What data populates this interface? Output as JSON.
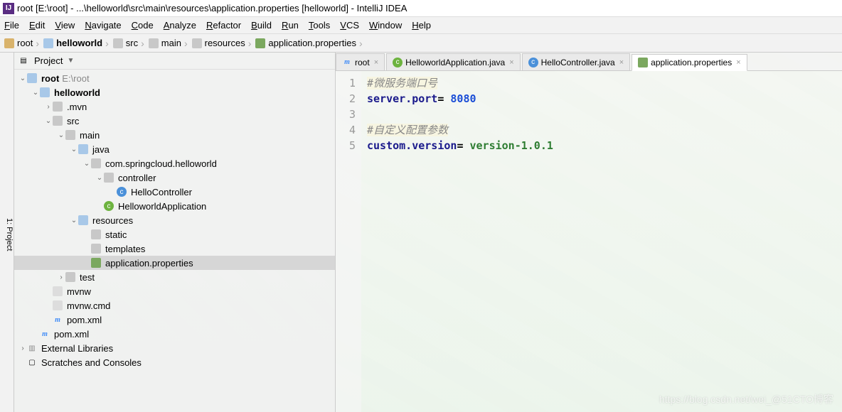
{
  "title": "root [E:\\root] - ...\\helloworld\\src\\main\\resources\\application.properties [helloworld] - IntelliJ IDEA",
  "menu": [
    "File",
    "Edit",
    "View",
    "Navigate",
    "Code",
    "Analyze",
    "Refactor",
    "Build",
    "Run",
    "Tools",
    "VCS",
    "Window",
    "Help"
  ],
  "breadcrumbs": [
    {
      "icon": "folder",
      "label": "root"
    },
    {
      "icon": "folder-blue",
      "label": "helloworld",
      "bold": true
    },
    {
      "icon": "folder-gray",
      "label": "src"
    },
    {
      "icon": "folder-gray",
      "label": "main"
    },
    {
      "icon": "folder-gray",
      "label": "resources"
    },
    {
      "icon": "prop",
      "label": "application.properties"
    }
  ],
  "project_label": "Project",
  "tree": [
    {
      "indent": 0,
      "tw": "v",
      "icon": "folder-blue",
      "label": "root",
      "hint": "E:\\root",
      "bold": true
    },
    {
      "indent": 1,
      "tw": "v",
      "icon": "folder-blue",
      "label": "helloworld",
      "bold": true
    },
    {
      "indent": 2,
      "tw": ">",
      "icon": "folder-gray",
      "label": ".mvn"
    },
    {
      "indent": 2,
      "tw": "v",
      "icon": "folder-gray",
      "label": "src"
    },
    {
      "indent": 3,
      "tw": "v",
      "icon": "folder-gray",
      "label": "main"
    },
    {
      "indent": 4,
      "tw": "v",
      "icon": "folder-blue",
      "label": "java"
    },
    {
      "indent": 5,
      "tw": "v",
      "icon": "folder-gray",
      "label": "com.springcloud.helloworld"
    },
    {
      "indent": 6,
      "tw": "v",
      "icon": "folder-gray",
      "label": "controller"
    },
    {
      "indent": 7,
      "tw": "",
      "icon": "class-c",
      "label": "HelloController"
    },
    {
      "indent": 6,
      "tw": "",
      "icon": "class",
      "label": "HelloworldApplication"
    },
    {
      "indent": 4,
      "tw": "v",
      "icon": "folder-blue",
      "label": "resources"
    },
    {
      "indent": 5,
      "tw": "",
      "icon": "folder-gray",
      "label": "static"
    },
    {
      "indent": 5,
      "tw": "",
      "icon": "folder-gray",
      "label": "templates"
    },
    {
      "indent": 5,
      "tw": "",
      "icon": "prop",
      "label": "application.properties",
      "selected": true
    },
    {
      "indent": 3,
      "tw": ">",
      "icon": "folder-gray",
      "label": "test"
    },
    {
      "indent": 2,
      "tw": "",
      "icon": "file",
      "label": "mvnw"
    },
    {
      "indent": 2,
      "tw": "",
      "icon": "file",
      "label": "mvnw.cmd"
    },
    {
      "indent": 2,
      "tw": "",
      "icon": "m",
      "label": "pom.xml"
    },
    {
      "indent": 1,
      "tw": "",
      "icon": "m",
      "label": "pom.xml"
    },
    {
      "indent": 0,
      "tw": ">",
      "icon": "lib",
      "label": "External Libraries"
    },
    {
      "indent": 0,
      "tw": "",
      "icon": "scratch",
      "label": "Scratches and Consoles"
    }
  ],
  "tabs": [
    {
      "icon": "m",
      "label": "root",
      "active": false
    },
    {
      "icon": "class",
      "label": "HelloworldApplication.java",
      "active": false
    },
    {
      "icon": "class-c",
      "label": "HelloController.java",
      "active": false
    },
    {
      "icon": "prop",
      "label": "application.properties",
      "active": true
    }
  ],
  "code": {
    "lines": [
      {
        "n": 1,
        "tokens": [
          {
            "cls": "hl-comment",
            "t": "#微服务端口号"
          }
        ]
      },
      {
        "n": 2,
        "tokens": [
          {
            "cls": "hl-key",
            "t": "server.port"
          },
          {
            "cls": "hl-eq",
            "t": "= "
          },
          {
            "cls": "hl-num",
            "t": "8080"
          }
        ]
      },
      {
        "n": 3,
        "tokens": []
      },
      {
        "n": 4,
        "tokens": [
          {
            "cls": "hl-comment",
            "t": "#自定义配置参数"
          }
        ]
      },
      {
        "n": 5,
        "tokens": [
          {
            "cls": "hl-key",
            "t": "custom.version"
          },
          {
            "cls": "hl-eq",
            "t": "= "
          },
          {
            "cls": "hl-str",
            "t": "version-1.0.1"
          }
        ]
      }
    ]
  },
  "watermark": "https://blog.csdn.net/wei_@51CTO博客",
  "sidebar_tab": "1: Project"
}
